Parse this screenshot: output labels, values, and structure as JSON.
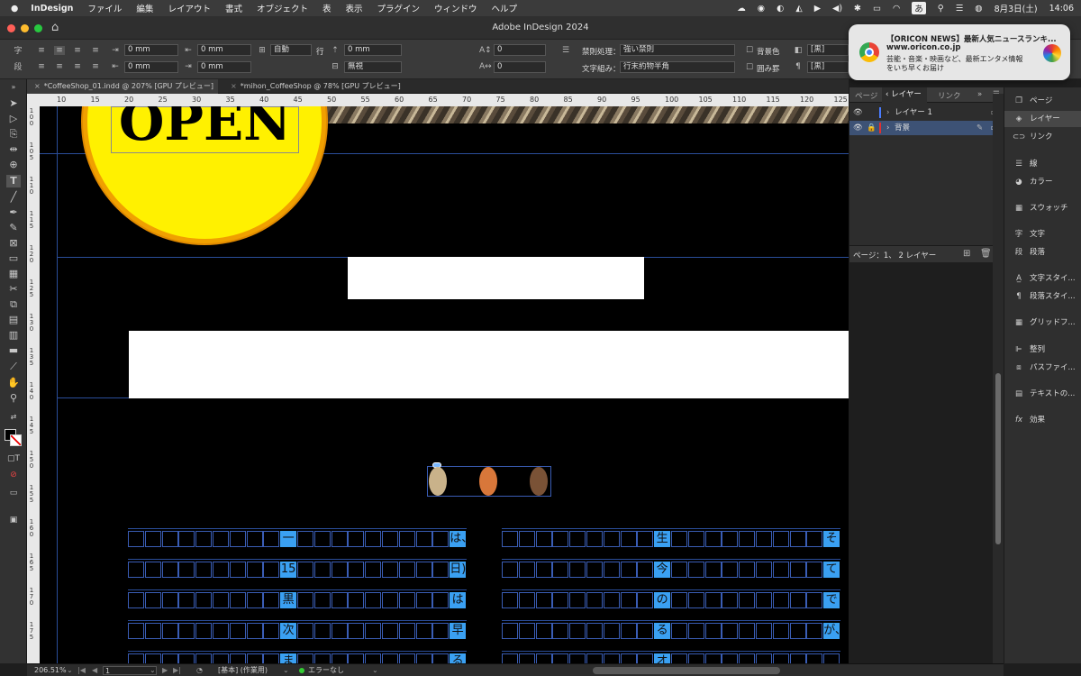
{
  "menubar": {
    "app": "InDesign",
    "items": [
      "ファイル",
      "編集",
      "レイアウト",
      "書式",
      "オブジェクト",
      "表",
      "表示",
      "プラグイン",
      "ウィンドウ",
      "ヘルプ"
    ],
    "ime": "あ",
    "date": "8月3日(土)",
    "time": "14:06"
  },
  "window": {
    "title": "Adobe InDesign 2024"
  },
  "control": {
    "indent_left": "0 mm",
    "indent_right": "0 mm",
    "indent_first": "0 mm",
    "indent_last": "0 mm",
    "autoLabel": "自動",
    "gyo": "行",
    "space_before": "0 mm",
    "muShi": "無視",
    "num1": "0",
    "num2": "0",
    "kinsoku_label": "禁則処理：",
    "kinsoku_value": "強い禁則",
    "mojikumi_label": "文字組み：",
    "mojikumi_value": "行末約物半角",
    "bg_color": "背景色",
    "frame_box": "囲み罫",
    "swatch1": "[黒]",
    "swatch2": "[黒]"
  },
  "tabs": [
    {
      "label": "*CoffeeShop_01.indd @ 207% [GPU プレビュー]",
      "active": true
    },
    {
      "label": "*mihon_CoffeeShop @ 78% [GPU プレビュー]",
      "active": false
    }
  ],
  "ruler": {
    "h": [
      "10",
      "15",
      "20",
      "25",
      "30",
      "35",
      "40",
      "45",
      "50",
      "55",
      "60",
      "65",
      "70",
      "75",
      "80",
      "85",
      "90",
      "95",
      "100",
      "105",
      "110",
      "115",
      "120",
      "125"
    ],
    "v": [
      "100",
      "105",
      "110",
      "115",
      "120",
      "125",
      "130",
      "135",
      "140",
      "145",
      "150",
      "155",
      "160",
      "165",
      "170",
      "175"
    ]
  },
  "canvas": {
    "open_text": "OPEN",
    "col_left": [
      [
        "一",
        "は、"
      ],
      [
        "15",
        "日)"
      ],
      [
        "黒",
        "は"
      ],
      [
        "次",
        "早"
      ],
      [
        "ま",
        "る"
      ]
    ],
    "col_right": [
      [
        "生",
        "そ"
      ],
      [
        "今",
        "て"
      ],
      [
        "の",
        "で"
      ],
      [
        "る",
        "が、"
      ],
      [
        "オ",
        ""
      ]
    ],
    "bean_colors": [
      "#c9b28a",
      "#d8773a",
      "#7a5236"
    ]
  },
  "layers": {
    "tabs": [
      "ページ",
      "レイヤー",
      "リンク"
    ],
    "rows": [
      "レイヤー 1",
      "背景"
    ],
    "footer": "ページ：1、 2 レイヤー"
  },
  "rpanel": {
    "items": [
      "ページ",
      "レイヤー",
      "リンク",
      "線",
      "カラー",
      "スウォッチ",
      "文字",
      "段落",
      "文字スタイ...",
      "段落スタイ...",
      "グリッドフ...",
      "整列",
      "パスファイ...",
      "テキストの...",
      "効果"
    ]
  },
  "status": {
    "zoom": "206.51%",
    "page": "1",
    "style": "[基本] (作業用)",
    "errors": "エラーなし"
  },
  "notification": {
    "title": "【ORICON NEWS】最新人気ニュースランキ...",
    "site": "www.oricon.co.jp",
    "body1": "芸能・音楽・映画など、最新エンタメ情報",
    "body2": "をいち早くお届け"
  }
}
